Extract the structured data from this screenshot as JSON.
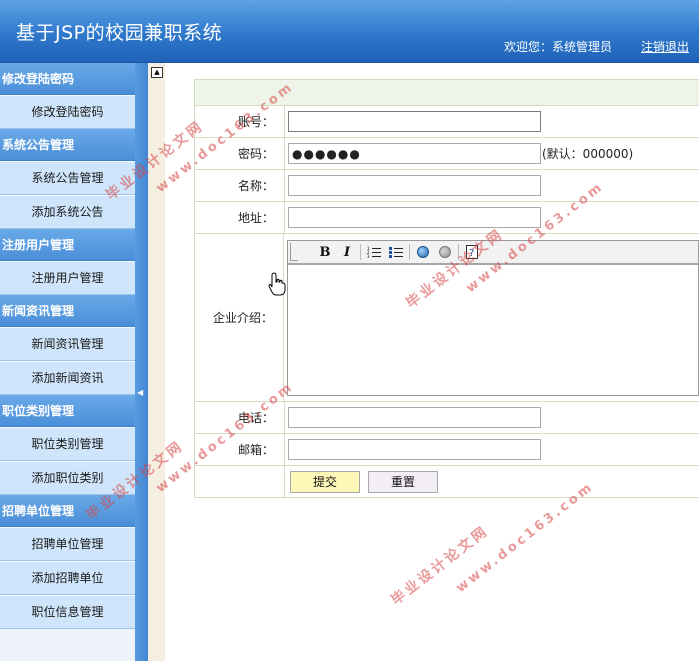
{
  "app": {
    "title": "基于JSP的校园兼职系统",
    "welcome": "欢迎您：系统管理员",
    "logout": "注销退出"
  },
  "sidebar": {
    "groups": [
      {
        "title": "修改登陆密码",
        "items": [
          "修改登陆密码"
        ]
      },
      {
        "title": "系统公告管理",
        "items": [
          "系统公告管理",
          "添加系统公告"
        ]
      },
      {
        "title": "注册用户管理",
        "items": [
          "注册用户管理"
        ]
      },
      {
        "title": "新闻资讯管理",
        "items": [
          "新闻资讯管理",
          "添加新闻资讯"
        ]
      },
      {
        "title": "职位类别管理",
        "items": [
          "职位类别管理",
          "添加职位类别"
        ]
      },
      {
        "title": "招聘单位管理",
        "items": [
          "招聘单位管理",
          "添加招聘单位",
          "职位信息管理"
        ]
      }
    ]
  },
  "form": {
    "account_label": "账号：",
    "account_value": "",
    "password_label": "密码：",
    "password_value": "●●●●●●",
    "password_hint": "(默认：000000)",
    "name_label": "名称：",
    "name_value": "",
    "address_label": "地址：",
    "address_value": "",
    "intro_label": "企业介绍：",
    "phone_label": "电话：",
    "phone_value": "",
    "email_label": "邮箱：",
    "email_value": "",
    "submit_label": "提交",
    "reset_label": "重置"
  },
  "editor_toolbar": {
    "bold": "B",
    "italic": "I",
    "icons": [
      "bold-icon",
      "italic-icon",
      "ordered-list-icon",
      "unordered-list-icon",
      "link-icon",
      "unlink-icon",
      "help-icon"
    ]
  },
  "watermark": {
    "line1": "毕业设计论文网",
    "line2": "www.doc163.com"
  }
}
